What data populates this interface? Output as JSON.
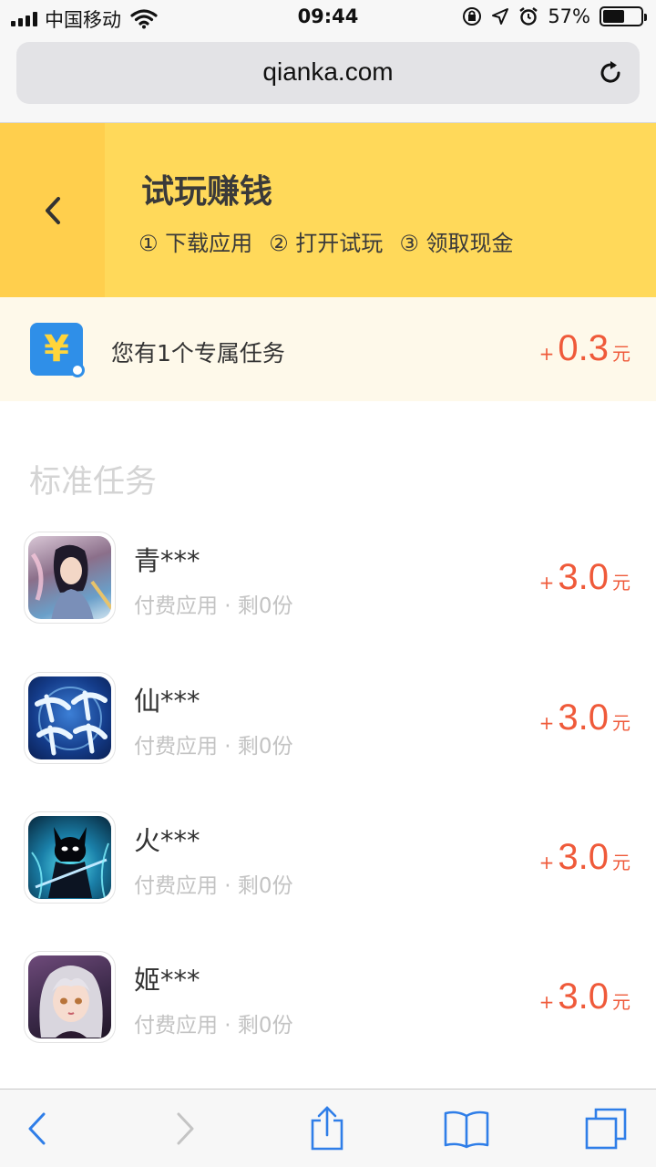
{
  "status_bar": {
    "carrier": "中国移动",
    "time": "09:44",
    "battery_text": "57%",
    "battery_level": 0.57
  },
  "browser": {
    "url": "qianka.com"
  },
  "banner": {
    "title": "试玩赚钱",
    "steps": [
      "① 下载应用",
      "② 打开试玩",
      "③ 领取现金"
    ]
  },
  "exclusive": {
    "icon_glyph": "¥",
    "text": "您有1个专属任务",
    "plus": "+",
    "amount": "0.3",
    "unit": "元"
  },
  "section_title": "标准任务",
  "tasks": [
    {
      "name": "青***",
      "meta": "付费应用 · 剩0份",
      "plus": "+",
      "amount": "3.0",
      "unit": "元",
      "icon": "game-icon-swordswoman"
    },
    {
      "name": "仙***",
      "meta": "付费应用 · 剩0份",
      "plus": "+",
      "amount": "3.0",
      "unit": "元",
      "icon": "game-icon-xianmo",
      "icon_text": "仙魔奇缘"
    },
    {
      "name": "火***",
      "meta": "付费应用 · 剩0份",
      "plus": "+",
      "amount": "3.0",
      "unit": "元",
      "icon": "game-icon-shadow-ninja"
    },
    {
      "name": "姬***",
      "meta": "付费应用 · 剩0份",
      "plus": "+",
      "amount": "3.0",
      "unit": "元",
      "icon": "game-icon-anime-girl"
    }
  ],
  "colors": {
    "banner": "#ffd95a",
    "back_area": "#ffcf4d",
    "reward": "#ef5a3a",
    "ios_blue": "#2f7ee8"
  }
}
